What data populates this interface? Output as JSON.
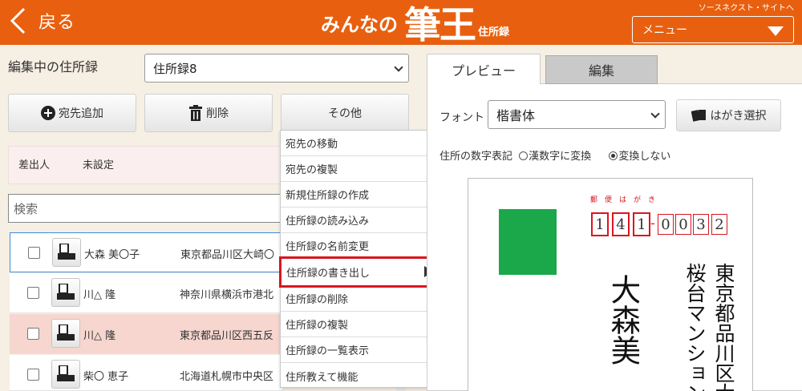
{
  "header": {
    "back_label": "戻る",
    "logo_pre": "みんなの",
    "logo_main": "筆王",
    "logo_sub": "住所録",
    "site_link": "ソースネクスト・サイトへ",
    "menu_label": "メニュー",
    "bg_color": "#e8600f"
  },
  "left": {
    "editing_label": "編集中の住所録",
    "book_selected": "住所録8",
    "buttons": {
      "add": "宛先追加",
      "delete": "削除",
      "other": "その他"
    },
    "sender": {
      "label": "差出人",
      "value": "未設定"
    },
    "search_placeholder": "検索",
    "rows": [
      {
        "name": "大森 美〇子",
        "address": "東京都品川区大崎〇"
      },
      {
        "name": "川△ 隆",
        "address": "神奈川県横浜市港北"
      },
      {
        "name": "川△ 隆",
        "address": "東京都品川区西五反"
      },
      {
        "name": "柴〇 恵子",
        "address": "北海道札幌市中央区"
      }
    ]
  },
  "dropdown": {
    "items": [
      "宛先の移動",
      "宛先の複製",
      "新規住所録の作成",
      "住所録の読み込み",
      "住所録の名前変更",
      "住所録の書き出し",
      "住所録の削除",
      "住所録の複製",
      "住所録の一覧表示",
      "住所教えて機能"
    ],
    "highlight_color": "#d9161f"
  },
  "right": {
    "tabs": {
      "preview": "プレビュー",
      "edit": "編集"
    },
    "font_label": "フォント",
    "font_value": "楷書体",
    "card_button": "はがき選択",
    "num_label": "住所の数字表記",
    "radio_kanji": "漢数字に変換",
    "radio_none": "変換しない",
    "postcard": {
      "stamp_label": "郵便はがき",
      "zip": [
        "1",
        "4",
        "1",
        "0",
        "0",
        "3",
        "2"
      ],
      "address1": "東京都品川区大",
      "address2": "桜台マンション",
      "name": "大森美",
      "stamp_color": "#1aa84b"
    }
  }
}
